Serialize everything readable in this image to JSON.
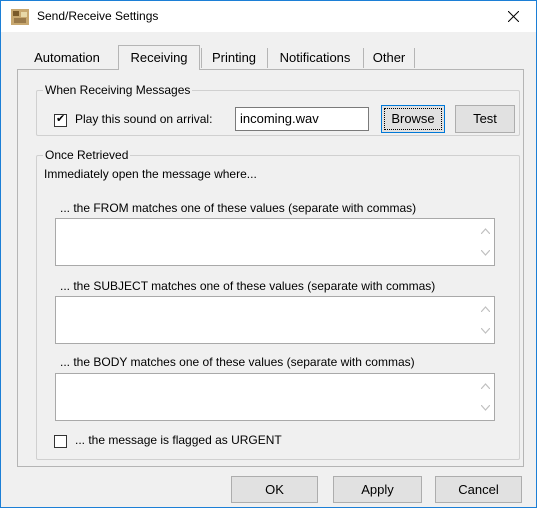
{
  "window": {
    "title": "Send/Receive Settings"
  },
  "tabs": [
    {
      "label": "Automation",
      "active": false
    },
    {
      "label": "Receiving",
      "active": true
    },
    {
      "label": "Printing",
      "active": false
    },
    {
      "label": "Notifications",
      "active": false
    },
    {
      "label": "Other",
      "active": false
    }
  ],
  "receiving": {
    "legend": "When Receiving Messages",
    "play_sound_label": "Play this sound on arrival:",
    "play_sound_checked": true,
    "sound_file": "incoming.wav",
    "browse_label": "Browse",
    "test_label": "Test"
  },
  "retrieved": {
    "legend": "Once Retrieved",
    "intro": "Immediately open the message where...",
    "from_label": "... the FROM matches one of these values (separate with commas)",
    "from_value": "",
    "subject_label": "... the SUBJECT matches one of these values (separate with commas)",
    "subject_value": "",
    "body_label": "... the BODY matches one of these values (separate with commas)",
    "body_value": "",
    "urgent_label": "... the message is flagged as URGENT",
    "urgent_checked": false
  },
  "footer": {
    "ok_label": "OK",
    "apply_label": "Apply",
    "cancel_label": "Cancel"
  }
}
